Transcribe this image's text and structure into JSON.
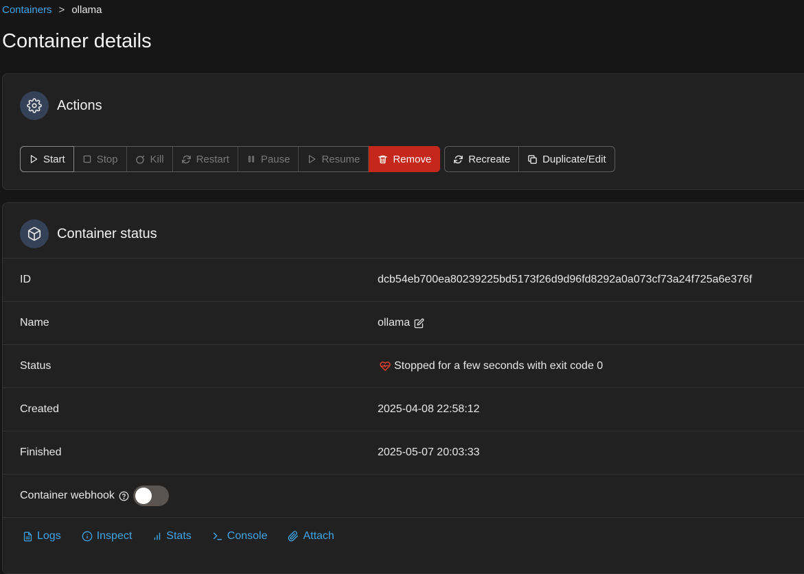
{
  "breadcrumb": {
    "parent": "Containers",
    "separator": ">",
    "current": "ollama"
  },
  "page_title": "Container details",
  "actions": {
    "title": "Actions",
    "buttons": {
      "start": "Start",
      "stop": "Stop",
      "kill": "Kill",
      "restart": "Restart",
      "pause": "Pause",
      "resume": "Resume",
      "remove": "Remove",
      "recreate": "Recreate",
      "duplicate": "Duplicate/Edit"
    }
  },
  "status": {
    "title": "Container status",
    "rows": {
      "id": {
        "label": "ID",
        "value": "dcb54eb700ea80239225bd5173f26d9d96fd8292a0a073cf73a24f725a6e376f"
      },
      "name": {
        "label": "Name",
        "value": "ollama"
      },
      "status": {
        "label": "Status",
        "value": "Stopped for a few seconds with exit code 0"
      },
      "created": {
        "label": "Created",
        "value": "2025-04-08 22:58:12"
      },
      "finished": {
        "label": "Finished",
        "value": "2025-05-07 20:03:33"
      },
      "webhook": {
        "label": "Container webhook",
        "enabled": false
      }
    },
    "links": {
      "logs": "Logs",
      "inspect": "Inspect",
      "stats": "Stats",
      "console": "Console",
      "attach": "Attach"
    }
  },
  "colors": {
    "accent": "#3ea6e8",
    "danger": "#c5271b",
    "background": "#161616",
    "card": "#212121"
  }
}
